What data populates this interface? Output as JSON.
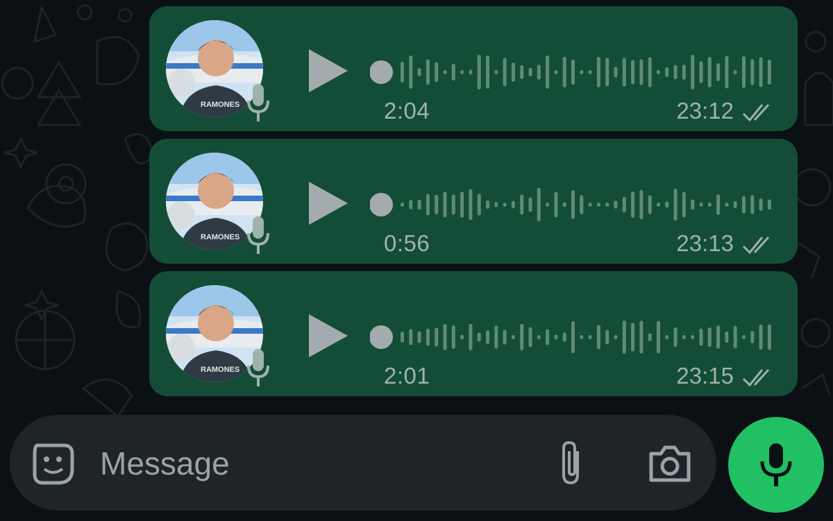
{
  "messages": [
    {
      "duration": "2:04",
      "time": "23:12",
      "status": "read"
    },
    {
      "duration": "0:56",
      "time": "23:13",
      "status": "read"
    },
    {
      "duration": "2:01",
      "time": "23:15",
      "status": "read"
    }
  ],
  "composer": {
    "placeholder": "Message",
    "emoji_icon": "sticker-emoji-icon",
    "attach_icon": "paperclip-icon",
    "camera_icon": "camera-icon"
  },
  "record_button": {
    "icon": "microphone-icon"
  },
  "colors": {
    "background": "#0b1014",
    "bubble": "#144d37",
    "composer": "#1e2428",
    "accent_green": "#21c063",
    "meta_text": "#9fb3aa"
  }
}
